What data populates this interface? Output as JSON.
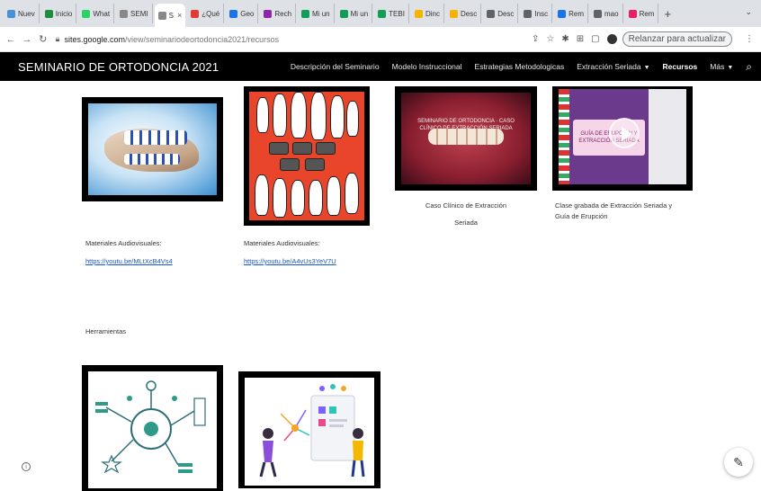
{
  "browser": {
    "tabs": [
      {
        "label": "Nuev",
        "color": "#4a90d9"
      },
      {
        "label": "Inicio",
        "color": "#1e8e3e"
      },
      {
        "label": "What",
        "color": "#25d366"
      },
      {
        "label": "SEMI",
        "color": "#888888"
      },
      {
        "label": "S",
        "color": "#888888",
        "active": true
      },
      {
        "label": "¿Qué",
        "color": "#e53935"
      },
      {
        "label": "Geo",
        "color": "#1a73e8"
      },
      {
        "label": "Rech",
        "color": "#8e24aa"
      },
      {
        "label": "Mi un",
        "color": "#0f9d58"
      },
      {
        "label": "Mi un",
        "color": "#0f9d58"
      },
      {
        "label": "TEBI",
        "color": "#0f9d58"
      },
      {
        "label": "Dinc",
        "color": "#f6b400"
      },
      {
        "label": "Desc",
        "color": "#f6b400"
      },
      {
        "label": "Desc",
        "color": "#5f6368"
      },
      {
        "label": "Insc",
        "color": "#5f6368"
      },
      {
        "label": "Rem",
        "color": "#1a73e8"
      },
      {
        "label": "mao",
        "color": "#5f6368"
      },
      {
        "label": "Rem",
        "color": "#e91e63"
      }
    ],
    "tab_close": "×",
    "new_tab": "+",
    "tab_menu": "⌄",
    "url_host": "sites.google.com",
    "url_path": "/view/seminariodeortodoncia2021/recursos",
    "update_button": "Relanzar para actualizar",
    "menu_dots": "⋮"
  },
  "site": {
    "title": "SEMINARIO DE ORTODONCIA 2021",
    "nav": [
      {
        "label": "Descripción del Seminario",
        "dropdown": false,
        "current": false
      },
      {
        "label": "Modelo Instruccional",
        "dropdown": false,
        "current": false
      },
      {
        "label": "Estrategias Metodologicas",
        "dropdown": false,
        "current": false
      },
      {
        "label": "Extracción Seriada",
        "dropdown": true,
        "current": false
      },
      {
        "label": "Recursos",
        "dropdown": false,
        "current": true
      },
      {
        "label": "Más",
        "dropdown": true,
        "current": false
      }
    ]
  },
  "content": {
    "caption_clinical_1": "Caso Clínico de Extracción",
    "caption_clinical_2": "Seriada",
    "caption_class_1": "Clase grabada de Extracción Seriada y",
    "caption_class_2": "Guía de Erupción",
    "video_overlay": "SEMINARIO DE ORTODONCIA · CASO CLÍNICO DE EXTRACCIÓN SERIADA",
    "slide_text": "GUÍA DE ERUPCIÓN Y EXTRACCIÓN SERIADA",
    "material_label_1": "Materiales Audiovisuales:",
    "material_link_1": "https://youtu.be/MLtXcB4Vs4",
    "material_label_2": "Materiales Audiovisuales:",
    "material_link_2": "https://youtu.be/A4vUs3YeV7U",
    "tools_heading": "Herramientas"
  }
}
